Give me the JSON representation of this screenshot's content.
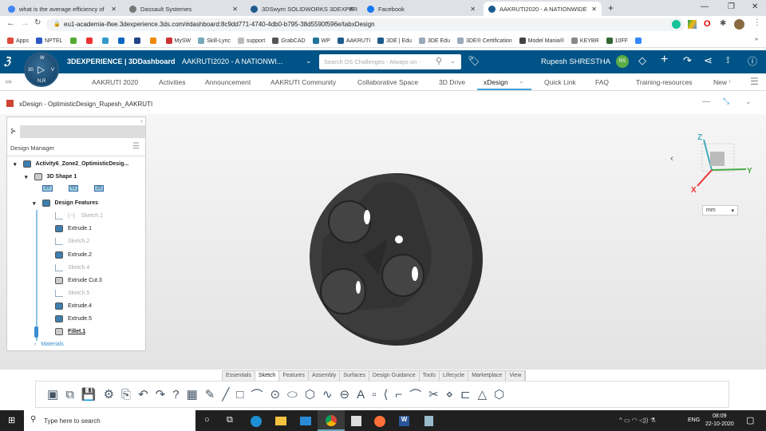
{
  "browser": {
    "tabs": [
      {
        "title": "what is the average efficiency of",
        "color": "#4285f4"
      },
      {
        "title": "Dassault Systemes",
        "color": "#666"
      },
      {
        "title": "3DSwym SOLIDWORKS 3DEXPER",
        "color": "#1d5b8c"
      },
      {
        "title": "Facebook",
        "color": "#1877f2"
      },
      {
        "title": "AAKRUTI2020 - A NATIONWIDE",
        "color": "#1d5b8c"
      }
    ],
    "url": "eu1-academia-ifwe.3dexperience.3ds.com/#dashboard:8c9dd771-4740-4db0-b795-38d5590f596e/tabxDesign",
    "bookmarks": [
      "Apps",
      "NPTEL",
      "",
      "",
      "",
      "",
      "",
      "",
      "MySW",
      "Skill-Lync",
      "support",
      "GrabCAD",
      "WP",
      "AAKRUTI",
      "3DE | Edu",
      "3DE Edu",
      "3DE® Certification",
      "Model Mania®",
      "KEYBR",
      "10FF",
      ""
    ],
    "bookmarks_more": "»"
  },
  "topbar": {
    "brand": "3DEXPERIENCE | 3DDashboard",
    "dashboard": "AAKRUTI2020 - A NATIONWI...",
    "search_placeholder": "Search DS Challenges - Always on -",
    "user": "Rupesh SHRESTHA",
    "initials": "RS",
    "compass_labels": [
      "W",
      "30",
      "V",
      "N,R"
    ]
  },
  "nav": {
    "items": [
      "AAKRUTI 2020",
      "Activities",
      "Announcement",
      "AAKRUTI Community",
      "Collaborative Space",
      "3D Drive",
      "xDesign",
      "Quick Link",
      "FAQ",
      "Training-resources",
      "New"
    ],
    "active": "xDesign"
  },
  "app": {
    "title": "xDesign - OptimisticDesign_Rupesh_AAKRUTI",
    "units": "mm"
  },
  "tree": {
    "header": "Design Manager",
    "root": "Activity6_Zone2_OptimisticDesig...",
    "shape": "3D Shape 1",
    "planes": [
      "XY",
      "YZ",
      "ZX"
    ],
    "features_label": "Design Features",
    "features": [
      {
        "label": "Sketch.1",
        "type": "sketch",
        "prefix": "(−)"
      },
      {
        "label": "Extrude.1",
        "type": "extrude"
      },
      {
        "label": "Sketch.2",
        "type": "sketch"
      },
      {
        "label": "Extrude.2",
        "type": "extrude"
      },
      {
        "label": "Sketch.4",
        "type": "sketch"
      },
      {
        "label": "Extrude Cut.3",
        "type": "cut"
      },
      {
        "label": "Sketch.5",
        "type": "sketch"
      },
      {
        "label": "Extrude.4",
        "type": "extrude"
      },
      {
        "label": "Extrude.5",
        "type": "extrude"
      },
      {
        "label": "Fillet.1",
        "type": "fillet"
      }
    ],
    "materials": "Materials"
  },
  "triad": {
    "x": "X",
    "y": "Y",
    "z": "Z"
  },
  "toolbar": {
    "tabs": [
      "Essentials",
      "Sketch",
      "Features",
      "Assembly",
      "Surfaces",
      "Design Guidance",
      "Tools",
      "Lifecycle",
      "Marketplace",
      "View"
    ],
    "active": "Sketch",
    "icons": [
      "▣",
      "⧉",
      "💾",
      "⚙",
      "⎘",
      "↶",
      "↷",
      "?",
      "▦",
      "✎",
      "╱",
      "□",
      "⌒",
      "⊙",
      "⬭",
      "⬡",
      "∿",
      "⊖",
      "A",
      "▫",
      "⟨",
      "⌐",
      "⌒",
      "✂",
      "⋄",
      "⊏",
      "△",
      "⬡"
    ]
  },
  "taskbar": {
    "search_placeholder": "Type here to search",
    "lang": "ENG",
    "time": "08:09",
    "date": "22-10-2020"
  },
  "colors": {
    "topbar": "#005386",
    "accent": "#42a2da",
    "model": "#3a3a3a"
  }
}
